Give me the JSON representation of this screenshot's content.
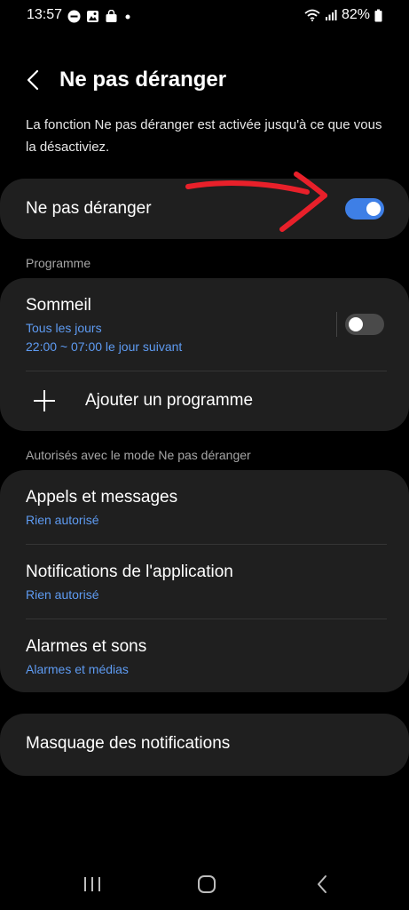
{
  "status_bar": {
    "time": "13:57",
    "battery_text": "82%",
    "icons_left": [
      "dnd-icon",
      "gallery-icon",
      "shopping-bag-icon",
      "dot-icon"
    ],
    "icons_right": [
      "wifi-icon",
      "signal-icon",
      "battery-icon"
    ]
  },
  "header": {
    "title": "Ne pas déranger",
    "back_icon": "chevron-left-icon"
  },
  "description": "La fonction Ne pas déranger est activée jusqu'à ce que vous la désactiviez.",
  "dnd_toggle": {
    "label": "Ne pas déranger",
    "checked": true
  },
  "program_section": {
    "label": "Programme",
    "schedules": [
      {
        "title": "Sommeil",
        "days": "Tous les jours",
        "time_range": "22:00 ~ 07:00 le jour suivant",
        "enabled": false
      }
    ],
    "add_label": "Ajouter un programme"
  },
  "allowed_section": {
    "label": "Autorisés avec le mode Ne pas déranger",
    "items": [
      {
        "title": "Appels et messages",
        "subtitle": "Rien autorisé"
      },
      {
        "title": "Notifications de l'application",
        "subtitle": "Rien autorisé"
      },
      {
        "title": "Alarmes et sons",
        "subtitle": "Alarmes et médias"
      }
    ]
  },
  "hide_notifications": {
    "label": "Masquage des notifications"
  },
  "nav_bar": {
    "buttons": [
      "recents-icon",
      "home-icon",
      "back-icon"
    ]
  },
  "colors": {
    "background": "#000000",
    "card": "#1f1f1f",
    "accent": "#5e9bf2",
    "toggle_on": "#3e7fe6",
    "annotation_arrow": "#e8202a"
  }
}
